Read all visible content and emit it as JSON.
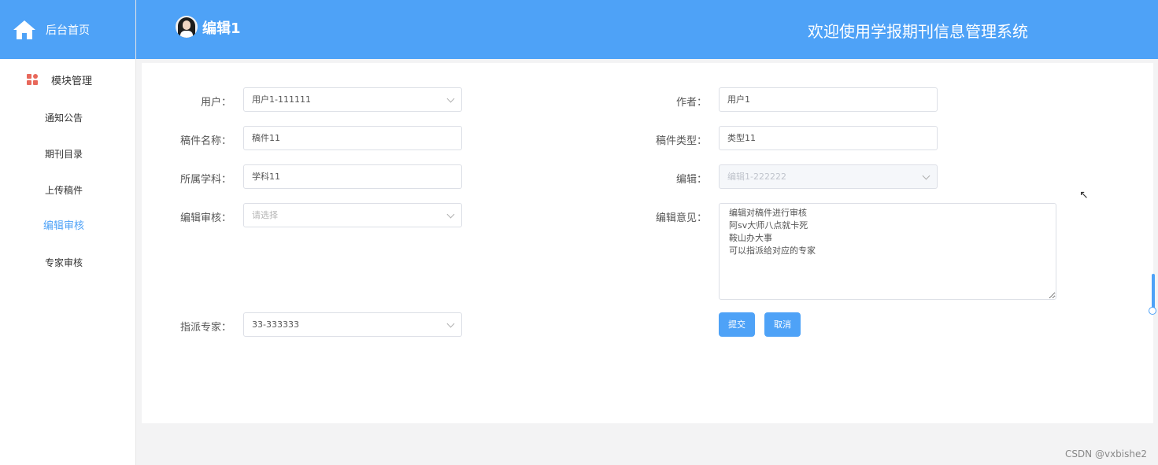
{
  "sidebar": {
    "brand_label": "后台首页",
    "group_label": "模块管理",
    "items": [
      {
        "label": "通知公告"
      },
      {
        "label": "期刊目录"
      },
      {
        "label": "上传稿件"
      },
      {
        "label": "编辑审核"
      },
      {
        "label": "专家审核"
      }
    ],
    "active_item": "编辑审核"
  },
  "header": {
    "user_name": "编辑1",
    "title": "欢迎使用学报期刊信息管理系统"
  },
  "form": {
    "user": {
      "label": "用户：",
      "value": "用户1-111111"
    },
    "author": {
      "label": "作者：",
      "value": "用户1"
    },
    "manuscript_name": {
      "label": "稿件名称：",
      "value": "稿件11"
    },
    "manuscript_type": {
      "label": "稿件类型：",
      "value": "类型11"
    },
    "subject": {
      "label": "所属学科：",
      "value": "学科11"
    },
    "editor": {
      "label": "编辑：",
      "value": "编辑1-222222"
    },
    "editor_review": {
      "label": "编辑审核：",
      "placeholder": "请选择"
    },
    "editor_opinion": {
      "label": "编辑意见：",
      "value": "编辑对稿件进行审核\n阿sv大师八点就卡死\n鞍山办大事\n可以指派给对应的专家"
    },
    "assign_expert": {
      "label": "指派专家：",
      "value": "33-333333"
    },
    "submit_label": "提交",
    "cancel_label": "取消"
  },
  "watermark": "CSDN @vxbishe2",
  "colors": {
    "primary": "#4ea2f7",
    "accent_icon": "#e8685b"
  }
}
